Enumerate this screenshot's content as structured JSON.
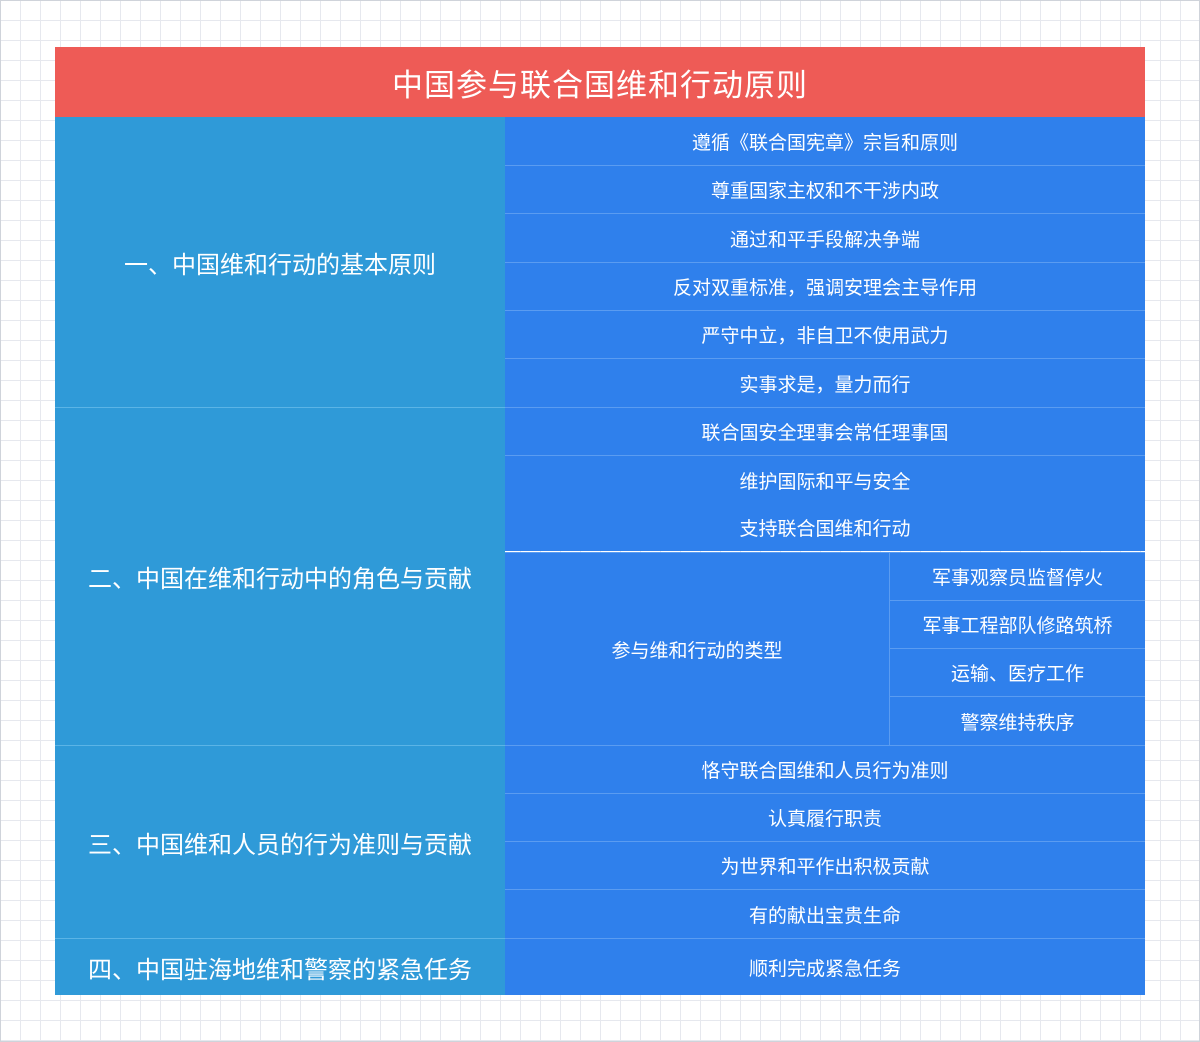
{
  "title": "中国参与联合国维和行动原则",
  "sections": [
    {
      "label": "一、中国维和行动的基本原则",
      "items": [
        "遵循《联合国宪章》宗旨和原则",
        "尊重国家主权和不干涉内政",
        "通过和平手段解决争端",
        "反对双重标准，强调安理会主导作用",
        "严守中立，非自卫不使用武力",
        "实事求是，量力而行"
      ]
    },
    {
      "label": "二、中国在维和行动中的角色与贡献",
      "items": [
        "联合国安全理事会常任理事国",
        "维护国际和平与安全",
        "支持联合国维和行动"
      ],
      "sub_group": {
        "label": "参与维和行动的类型",
        "items": [
          "军事观察员监督停火",
          "军事工程部队修路筑桥",
          "运输、医疗工作",
          "警察维持秩序"
        ]
      }
    },
    {
      "label": "三、中国维和人员的行为准则与贡献",
      "items": [
        "恪守联合国维和人员行为准则",
        "认真履行职责",
        "为世界和平作出积极贡献",
        "有的献出宝贵生命"
      ]
    },
    {
      "label": "四、中国驻海地维和警察的紧急任务",
      "items": [
        "顺利完成紧急任务"
      ]
    }
  ],
  "colors": {
    "title_bg": "#ee5b56",
    "section_bg": "#2f9ad8",
    "item_bg": "#2f80ec",
    "text": "#ffffff"
  }
}
